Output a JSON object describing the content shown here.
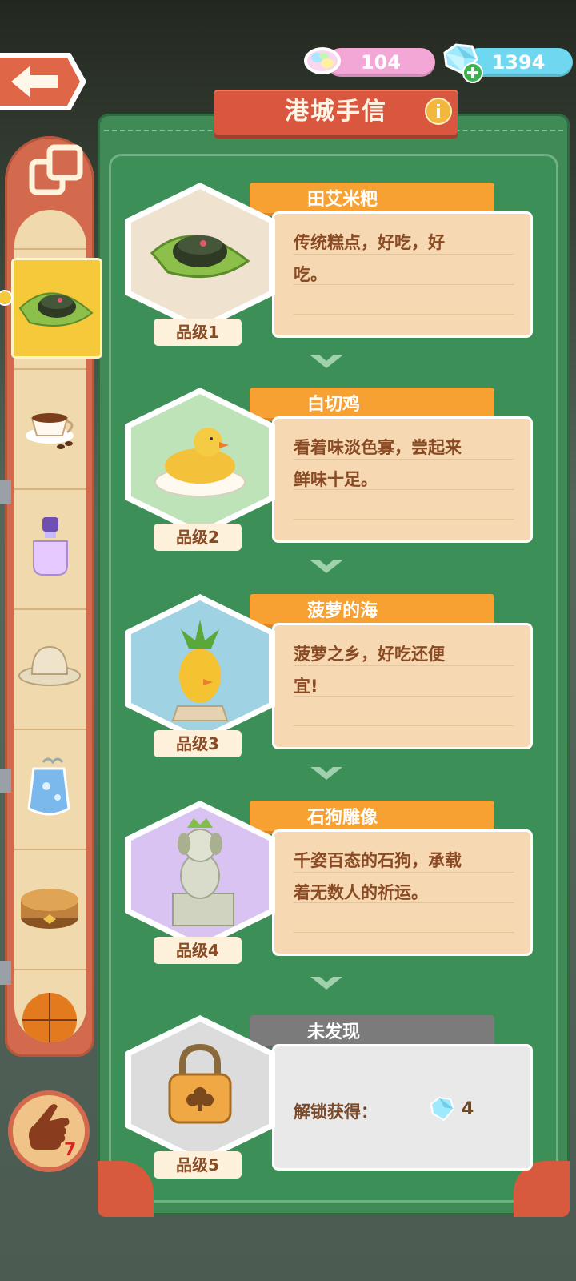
{
  "currency": {
    "candy_amount": "104",
    "gem_amount": "1394"
  },
  "panel": {
    "title": "港城手信"
  },
  "cards": [
    {
      "name": "田艾米粑",
      "desc_line1": "传统糕点，好吃，好",
      "desc_line2": "吃。",
      "grade": "品级1",
      "locked": false
    },
    {
      "name": "白切鸡",
      "desc_line1": "看着味淡色寡，尝起来",
      "desc_line2": "鲜味十足。",
      "grade": "品级2",
      "locked": false
    },
    {
      "name": "菠萝的海",
      "desc_line1": "菠萝之乡，好吃还便",
      "desc_line2": "宜!",
      "grade": "品级3",
      "locked": false
    },
    {
      "name": "石狗雕像",
      "desc_line1": "千姿百态的石狗，承载",
      "desc_line2": "着无数人的祈运。",
      "grade": "品级4",
      "locked": false
    },
    {
      "name": "未发现",
      "unlock_label": "解锁获得：",
      "unlock_amount": "4",
      "grade": "品级5",
      "locked": true
    }
  ],
  "hand": {
    "count": "7"
  },
  "sidebar_items": [
    "rice-cake-icon",
    "coffee-cup-icon",
    "perfume-icon",
    "hat-icon",
    "charm-icon",
    "leather-box-icon",
    "basketball-icon"
  ]
}
